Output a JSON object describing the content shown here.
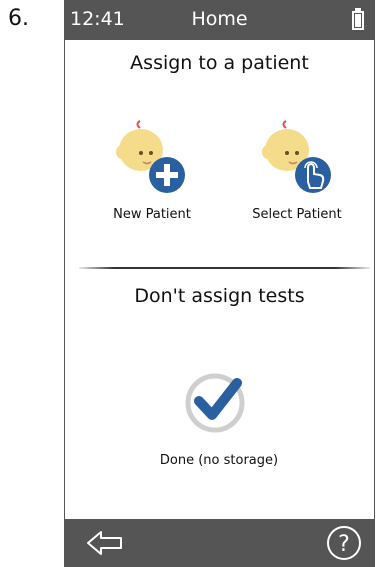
{
  "step_number": "6.",
  "status_bar": {
    "time": "12:41",
    "title": "Home",
    "battery_icon": "battery-full-icon"
  },
  "assign_section": {
    "title": "Assign to a patient",
    "options": [
      {
        "label": "New Patient",
        "icon": "baby-add-icon"
      },
      {
        "label": "Select Patient",
        "icon": "baby-select-icon"
      }
    ]
  },
  "dont_assign_section": {
    "title": "Don't assign tests",
    "option": {
      "label": "Done (no storage)",
      "icon": "checkmark-icon"
    }
  },
  "bottom_bar": {
    "back_icon": "back-arrow-icon",
    "help_icon": "help-icon"
  },
  "colors": {
    "status_bar": "#555555",
    "accent_blue": "#2a5fa0",
    "baby_skin": "#f5dc8a",
    "check_ring": "#cfcfcf"
  }
}
